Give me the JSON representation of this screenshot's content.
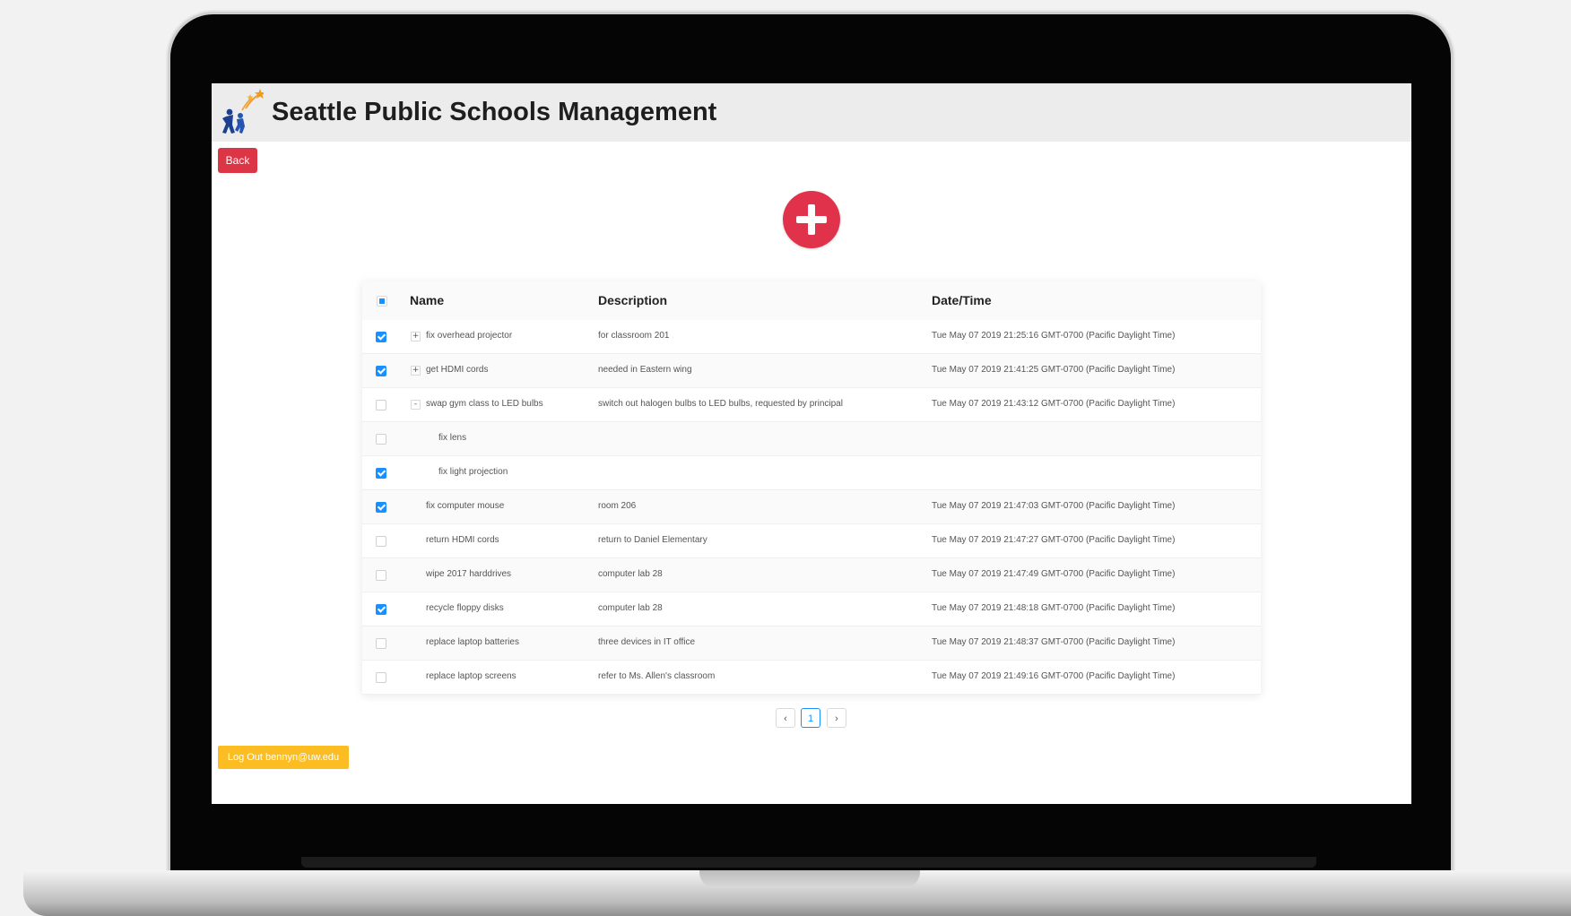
{
  "app": {
    "title": "Seattle Public Schools Management"
  },
  "nav": {
    "back_label": "Back",
    "logout_label": "Log Out bennyn@uw.edu"
  },
  "colors": {
    "accent_red": "#dc3545",
    "add_button": "#e0334b",
    "checkbox_blue": "#1890ff",
    "logout_yellow": "#fbbd21"
  },
  "icons": {
    "add": "plus-icon",
    "prev": "chevron-left-icon",
    "next": "chevron-right-icon",
    "logo": "stars-children-logo"
  },
  "table": {
    "columns": [
      "Name",
      "Description",
      "Date/Time"
    ],
    "rows": [
      {
        "checked": true,
        "expander": "+",
        "child": false,
        "name": "fix overhead projector",
        "description": "for classroom 201",
        "datetime": "Tue May 07 2019 21:25:16 GMT-0700 (Pacific Daylight Time)"
      },
      {
        "checked": true,
        "expander": "+",
        "child": false,
        "name": "get HDMI cords",
        "description": "needed in Eastern wing",
        "datetime": "Tue May 07 2019 21:41:25 GMT-0700 (Pacific Daylight Time)"
      },
      {
        "checked": false,
        "expander": "-",
        "child": false,
        "name": "swap gym class to LED bulbs",
        "description": "switch out halogen bulbs to LED bulbs, requested by principal",
        "datetime": "Tue May 07 2019 21:43:12 GMT-0700 (Pacific Daylight Time)"
      },
      {
        "checked": false,
        "expander": "",
        "child": true,
        "name": "fix lens",
        "description": "",
        "datetime": ""
      },
      {
        "checked": true,
        "expander": "",
        "child": true,
        "name": "fix light projection",
        "description": "",
        "datetime": ""
      },
      {
        "checked": true,
        "expander": "",
        "child": false,
        "name": "fix computer mouse",
        "description": "room 206",
        "datetime": "Tue May 07 2019 21:47:03 GMT-0700 (Pacific Daylight Time)"
      },
      {
        "checked": false,
        "expander": "",
        "child": false,
        "name": "return HDMI cords",
        "description": "return to Daniel Elementary",
        "datetime": "Tue May 07 2019 21:47:27 GMT-0700 (Pacific Daylight Time)"
      },
      {
        "checked": false,
        "expander": "",
        "child": false,
        "name": "wipe 2017 harddrives",
        "description": "computer lab 28",
        "datetime": "Tue May 07 2019 21:47:49 GMT-0700 (Pacific Daylight Time)"
      },
      {
        "checked": true,
        "expander": "",
        "child": false,
        "name": "recycle floppy disks",
        "description": "computer lab 28",
        "datetime": "Tue May 07 2019 21:48:18 GMT-0700 (Pacific Daylight Time)"
      },
      {
        "checked": false,
        "expander": "",
        "child": false,
        "name": "replace laptop batteries",
        "description": "three devices in IT office",
        "datetime": "Tue May 07 2019 21:48:37 GMT-0700 (Pacific Daylight Time)"
      },
      {
        "checked": false,
        "expander": "",
        "child": false,
        "name": "replace laptop screens",
        "description": "refer to Ms. Allen's classroom",
        "datetime": "Tue May 07 2019 21:49:16 GMT-0700 (Pacific Daylight Time)"
      }
    ]
  },
  "pagination": {
    "prev": "‹",
    "current": "1",
    "next": "›"
  }
}
